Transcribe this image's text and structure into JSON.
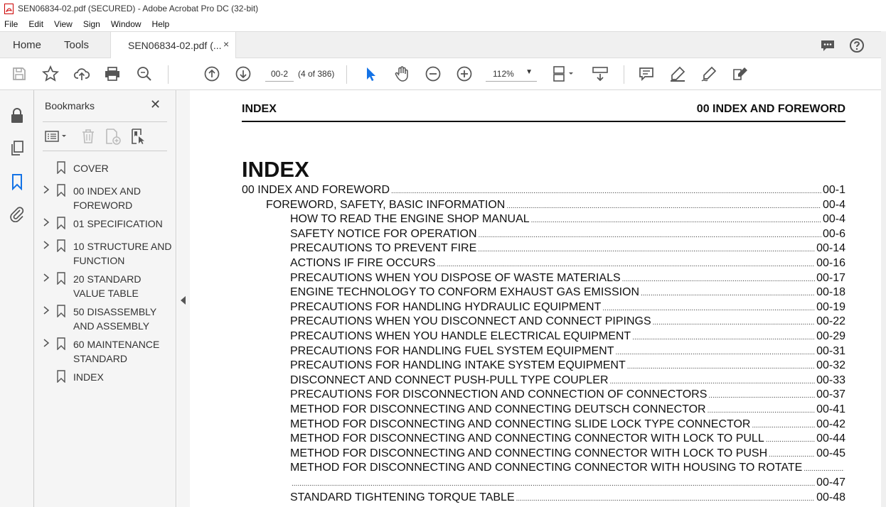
{
  "window": {
    "title": "SEN06834-02.pdf (SECURED) - Adobe Acrobat Pro DC (32-bit)"
  },
  "menu": [
    "File",
    "Edit",
    "View",
    "Sign",
    "Window",
    "Help"
  ],
  "tabs": {
    "home": "Home",
    "tools": "Tools",
    "document": "SEN06834-02.pdf (...",
    "close_glyph": "×"
  },
  "toolbar": {
    "page_value": "00-2",
    "page_count": "(4 of 386)",
    "zoom": "112%",
    "zoom_caret": "▼"
  },
  "bookmarks": {
    "title": "Bookmarks",
    "close_glyph": "✕",
    "items": [
      {
        "label": "COVER",
        "expandable": false
      },
      {
        "label": "00 INDEX AND FOREWORD",
        "expandable": true
      },
      {
        "label": "01 SPECIFICATION",
        "expandable": true
      },
      {
        "label": "10 STRUCTURE AND FUNCTION",
        "expandable": true
      },
      {
        "label": "20 STANDARD VALUE TABLE",
        "expandable": true
      },
      {
        "label": "50 DISASSEMBLY AND ASSEMBLY",
        "expandable": true
      },
      {
        "label": "60 MAINTENANCE STANDARD",
        "expandable": true
      },
      {
        "label": "INDEX",
        "expandable": false
      }
    ]
  },
  "document": {
    "header_left": "INDEX",
    "header_right": "00 INDEX AND FOREWORD",
    "title": "INDEX",
    "toc": [
      {
        "text": "00 INDEX AND FOREWORD",
        "page": "00-1",
        "level": 0
      },
      {
        "text": "FOREWORD, SAFETY, BASIC INFORMATION",
        "page": "00-4",
        "level": 1
      },
      {
        "text": "HOW TO READ THE ENGINE SHOP MANUAL",
        "page": "00-4",
        "level": 2
      },
      {
        "text": "SAFETY NOTICE FOR OPERATION",
        "page": "00-6",
        "level": 2
      },
      {
        "text": "PRECAUTIONS TO PREVENT FIRE",
        "page": "00-14",
        "level": 2
      },
      {
        "text": "ACTIONS IF FIRE OCCURS",
        "page": "00-16",
        "level": 2
      },
      {
        "text": "PRECAUTIONS WHEN YOU DISPOSE OF WASTE MATERIALS",
        "page": "00-17",
        "level": 2
      },
      {
        "text": "ENGINE TECHNOLOGY TO CONFORM EXHAUST GAS EMISSION",
        "page": "00-18",
        "level": 2
      },
      {
        "text": "PRECAUTIONS FOR HANDLING HYDRAULIC EQUIPMENT",
        "page": "00-19",
        "level": 2
      },
      {
        "text": "PRECAUTIONS WHEN YOU DISCONNECT AND CONNECT PIPINGS",
        "page": "00-22",
        "level": 2
      },
      {
        "text": "PRECAUTIONS WHEN YOU HANDLE ELECTRICAL EQUIPMENT",
        "page": "00-29",
        "level": 2
      },
      {
        "text": "PRECAUTIONS FOR HANDLING FUEL SYSTEM EQUIPMENT",
        "page": "00-31",
        "level": 2
      },
      {
        "text": "PRECAUTIONS FOR HANDLING INTAKE SYSTEM EQUIPMENT",
        "page": "00-32",
        "level": 2
      },
      {
        "text": "DISCONNECT AND CONNECT PUSH-PULL TYPE COUPLER",
        "page": "00-33",
        "level": 2
      },
      {
        "text": "PRECAUTIONS FOR DISCONNECTION AND CONNECTION OF CONNECTORS",
        "page": "00-37",
        "level": 2
      },
      {
        "text": "METHOD FOR DISCONNECTING AND CONNECTING DEUTSCH CONNECTOR",
        "page": "00-41",
        "level": 2
      },
      {
        "text": "METHOD FOR DISCONNECTING AND CONNECTING SLIDE LOCK TYPE CONNECTOR",
        "page": "00-42",
        "level": 2
      },
      {
        "text": "METHOD FOR DISCONNECTING AND CONNECTING CONNECTOR WITH LOCK TO PULL",
        "page": "00-44",
        "level": 2
      },
      {
        "text": "METHOD FOR DISCONNECTING AND CONNECTING CONNECTOR WITH LOCK TO PUSH",
        "page": "00-45",
        "level": 2
      },
      {
        "text": "METHOD FOR DISCONNECTING AND CONNECTING CONNECTOR WITH HOUSING TO ROTATE",
        "page": "",
        "level": 2
      },
      {
        "text": "",
        "page": "00-47",
        "level": 3
      },
      {
        "text": "STANDARD TIGHTENING TORQUE TABLE",
        "page": "00-48",
        "level": 2
      }
    ]
  },
  "icons": {
    "accent": "#1473e6"
  }
}
